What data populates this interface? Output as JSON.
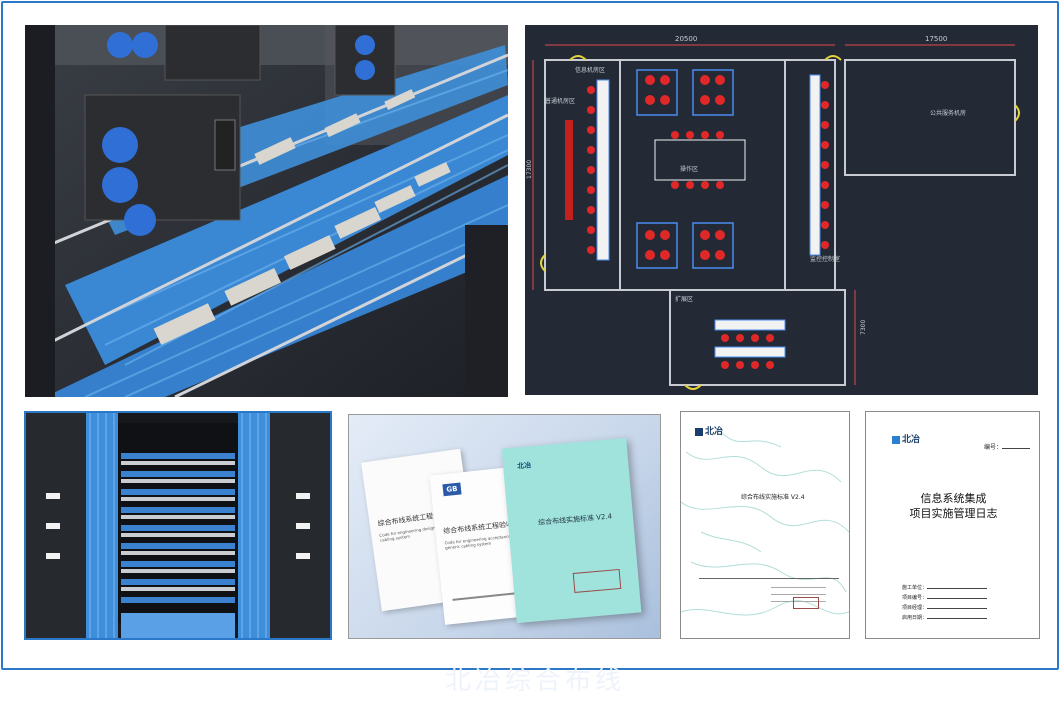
{
  "cad": {
    "dim_top_left": "20500",
    "dim_top_right": "17500",
    "dim_left": "17300",
    "dim_right_bottom": "7300",
    "rooms": [
      "信息机房区",
      "普通机房区",
      "操作区",
      "公共服务机房",
      "监控控制室",
      "扩展区"
    ]
  },
  "booklets": {
    "gb_logo": "GB",
    "doc1_title": "综合布线系统工程设计规范",
    "doc1_sub": "Code for engineering design of generic cabling system",
    "doc2_title": "综合布线系统工程验收规范",
    "doc2_sub": "Code for engineering acceptance of generic cabling system",
    "doc3_logo": "北冶",
    "doc3_title": "综合布线实施标准 V2.4"
  },
  "cover_standard": {
    "logo": "北冶",
    "title": "综合布线实施标准 V2.4"
  },
  "cover_log": {
    "logo": "北冶",
    "number_label": "编号：",
    "title_line1": "信息系统集成",
    "title_line2": "项目实施管理日志",
    "fields": [
      "施工单位：",
      "项目编号：",
      "项目经理：",
      "启用日期："
    ]
  },
  "colors": {
    "frame": "#2b78c8",
    "cable_blue": "#3d8fdc",
    "cad_bg": "#232a36",
    "teal_booklet": "#9fe3dc"
  },
  "watermark": "北冶综合布线"
}
